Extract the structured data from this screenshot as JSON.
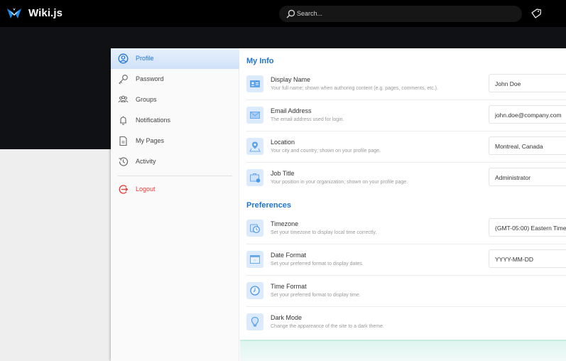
{
  "header": {
    "brand": "Wiki.js",
    "search_placeholder": "Search..."
  },
  "sidebar": {
    "items": [
      {
        "label": "Profile",
        "icon": "account-circle-icon",
        "active": true
      },
      {
        "label": "Password",
        "icon": "key-icon"
      },
      {
        "label": "Groups",
        "icon": "groups-icon"
      },
      {
        "label": "Notifications",
        "icon": "bell-icon"
      },
      {
        "label": "My Pages",
        "icon": "document-icon"
      },
      {
        "label": "Activity",
        "icon": "history-icon"
      }
    ],
    "logout": {
      "label": "Logout",
      "icon": "logout-icon"
    }
  },
  "sections": {
    "my_info": {
      "title": "My Info",
      "rows": [
        {
          "title": "Display Name",
          "desc": "Your full name; shown when authoring content (e.g. pages, comments, etc.).",
          "value": "John Doe",
          "icon": "id-card-icon"
        },
        {
          "title": "Email Address",
          "desc": "The email address used for login.",
          "value": "john.doe@company.com",
          "icon": "envelope-icon"
        },
        {
          "title": "Location",
          "desc": "Your city and country; shown on your profile page.",
          "value": "Montreal, Canada",
          "icon": "map-pin-icon"
        },
        {
          "title": "Job Title",
          "desc": "Your position in your organization; shown on your profile page.",
          "value": "Administrator",
          "icon": "briefcase-icon"
        }
      ]
    },
    "preferences": {
      "title": "Preferences",
      "rows": [
        {
          "title": "Timezone",
          "desc": "Set your timezone to display local time correctly.",
          "value": "(GMT-05:00) Eastern Time",
          "icon": "timezone-icon"
        },
        {
          "title": "Date Format",
          "desc": "Set your preferred format to display dates.",
          "value": "YYYY-MM-DD",
          "icon": "calendar-icon"
        },
        {
          "title": "Time Format",
          "desc": "Set your preferred format to display time.",
          "icon": "clock-icon"
        },
        {
          "title": "Dark Mode",
          "desc": "Change the appareance of the site to a dark theme.",
          "icon": "lightbulb-icon"
        }
      ]
    }
  },
  "colors": {
    "accent": "#1e74d2",
    "logout": "#e53935",
    "topbar": "#000000",
    "hero": "#0f1115"
  }
}
